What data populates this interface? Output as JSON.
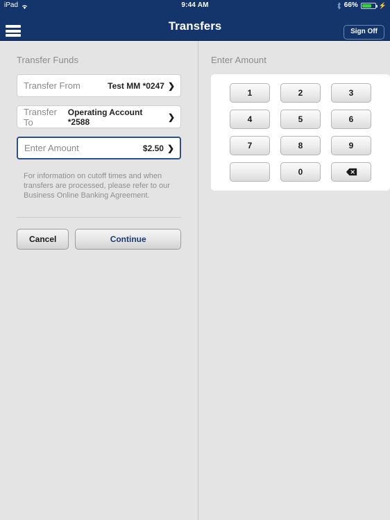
{
  "status_bar": {
    "device_label": "iPad",
    "wifi_icon": "wifi-icon",
    "time": "9:44 AM",
    "bluetooth_icon": "bluetooth-icon",
    "battery_percent": "66%",
    "battery_level": 66,
    "battery_icon": "battery-icon"
  },
  "nav_bar": {
    "menu_icon": "hamburger-menu-icon",
    "title": "Transfers",
    "sign_off_label": "Sign Off",
    "background_color": "#14356c"
  },
  "left_pane": {
    "section_title": "Transfer Funds",
    "fields": [
      {
        "label": "Transfer From",
        "value": "Test MM *0247",
        "chevron": "❯",
        "active": false
      },
      {
        "label": "Transfer To",
        "value": "Operating Account *2588",
        "chevron": "❯",
        "active": false
      },
      {
        "label": "Enter Amount",
        "value": "$2.50",
        "chevron": "❯",
        "active": true
      }
    ],
    "note": "For information on cutoff times and when transfers are processed, please refer to our Business Online Banking Agreement.",
    "cancel_label": "Cancel",
    "continue_label": "Continue",
    "continue_color": "#1b3a75"
  },
  "right_pane": {
    "section_title": "Enter Amount",
    "keypad": {
      "keys": [
        {
          "label": "1",
          "name": "key-1",
          "type": "digit"
        },
        {
          "label": "2",
          "name": "key-2",
          "type": "digit"
        },
        {
          "label": "3",
          "name": "key-3",
          "type": "digit"
        },
        {
          "label": "4",
          "name": "key-4",
          "type": "digit"
        },
        {
          "label": "5",
          "name": "key-5",
          "type": "digit"
        },
        {
          "label": "6",
          "name": "key-6",
          "type": "digit"
        },
        {
          "label": "7",
          "name": "key-7",
          "type": "digit"
        },
        {
          "label": "8",
          "name": "key-8",
          "type": "digit"
        },
        {
          "label": "9",
          "name": "key-9",
          "type": "digit"
        },
        {
          "label": "",
          "name": "key-blank",
          "type": "blank"
        },
        {
          "label": "0",
          "name": "key-0",
          "type": "digit"
        },
        {
          "label": "",
          "name": "key-backspace",
          "type": "backspace"
        }
      ]
    }
  }
}
